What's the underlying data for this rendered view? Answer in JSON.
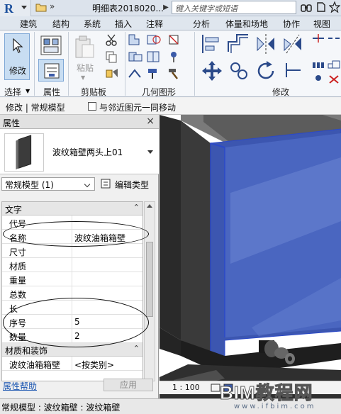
{
  "titlebar": {
    "app_logo": "R",
    "title": "明细表2018020...",
    "search_placeholder": "键入关键字或短语",
    "icons": [
      "binoculars-icon",
      "star-icon",
      "star-icon"
    ]
  },
  "ribbon_tabs": [
    "建筑",
    "结构",
    "系统",
    "插入",
    "注释",
    "分析",
    "体量和场地",
    "协作",
    "视图"
  ],
  "ribbon": {
    "modify_label": "修改",
    "paste_label": "粘贴",
    "panels": {
      "select": "选择",
      "properties": "属性",
      "clipboard": "剪贴板",
      "geometry": "几何图形",
      "modify": "修改"
    }
  },
  "options_bar": {
    "context": "修改 | 常规模型",
    "checkbox_label": "与邻近图元一同移动",
    "checkbox_checked": false
  },
  "properties": {
    "title": "属性",
    "type_name": "波纹箱壁两头上01",
    "filter_value": "常规模型 (1)",
    "edit_type_label": "编辑类型",
    "groups": [
      {
        "name": "文字",
        "rows": [
          {
            "key": "代号",
            "value": ""
          },
          {
            "key": "名称",
            "value": "波纹油箱箱壁"
          },
          {
            "key": "尺寸",
            "value": ""
          },
          {
            "key": "材质",
            "value": ""
          },
          {
            "key": "重量",
            "value": ""
          },
          {
            "key": "总数",
            "value": ""
          },
          {
            "key": "长",
            "value": ""
          },
          {
            "key": "序号",
            "value": "5"
          },
          {
            "key": "数量",
            "value": "2"
          }
        ]
      },
      {
        "name": "材质和装饰",
        "rows": [
          {
            "key": "波纹油箱箱壁",
            "value": "<按类别>"
          }
        ]
      }
    ],
    "help_label": "属性帮助",
    "apply_label": "应用"
  },
  "view": {
    "scale": "1 : 100"
  },
  "status_bar": {
    "text": "常规模型 : 波纹箱壁 : 波纹箱壁"
  },
  "watermark": {
    "main": "BIM教程网",
    "sub": "www.ifbim.com"
  },
  "colors": {
    "accent_blue": "#3a5aa8",
    "selection_blue": "#2b49c9",
    "ribbon_bg": "#f5f7fa"
  }
}
